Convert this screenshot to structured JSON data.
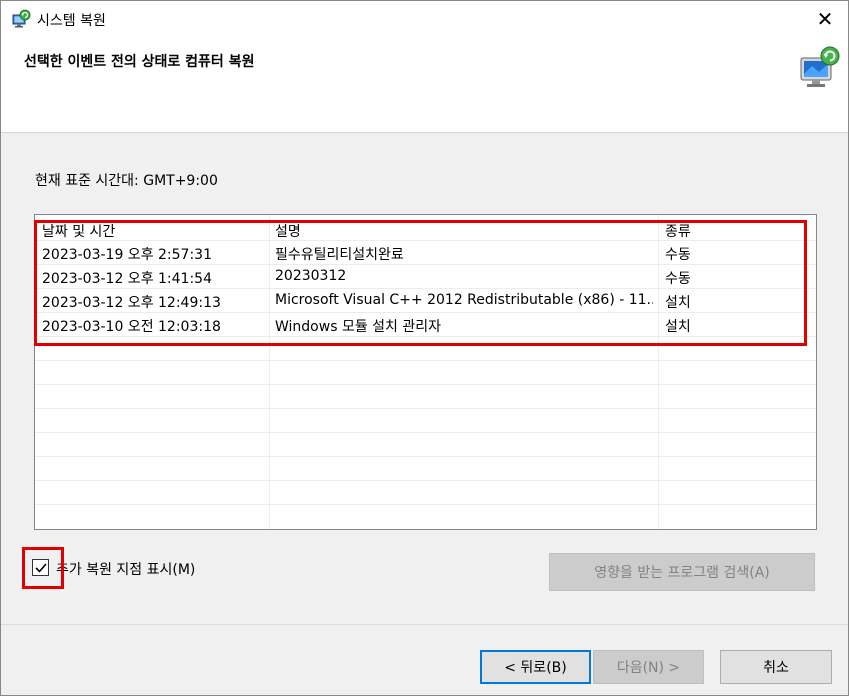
{
  "window": {
    "title": "시스템 복원",
    "close_glyph": "✕"
  },
  "header": {
    "heading": "선택한 이벤트 전의 상태로 컴퓨터 복원"
  },
  "timezone_label": "현재 표준 시간대: GMT+9:00",
  "table": {
    "columns": [
      "날짜 및 시간",
      "설명",
      "종류"
    ],
    "rows": [
      {
        "date": "2023-03-19 오후 2:57:31",
        "description": "필수유틸리티설치완료",
        "type": "수동"
      },
      {
        "date": "2023-03-12 오후 1:41:54",
        "description": "20230312",
        "type": "수동"
      },
      {
        "date": "2023-03-12 오후 12:49:13",
        "description": "Microsoft Visual C++ 2012 Redistributable (x86) - 11....",
        "type": "설치"
      },
      {
        "date": "2023-03-10 오전 12:03:18",
        "description": "Windows 모듈 설치 관리자",
        "type": "설치"
      }
    ]
  },
  "show_more": {
    "label": "추가 복원 지점 표시(M)",
    "checked": true
  },
  "buttons": {
    "scan": "영향을 받는 프로그램 검색(A)",
    "back": "< 뒤로(B)",
    "next": "다음(N) >",
    "cancel": "취소"
  },
  "icons": {
    "app": "system-restore-icon",
    "header": "system-restore-computer-icon"
  },
  "colors": {
    "highlight": "#e00000",
    "accent": "#0078d7",
    "dialog_bg": "#f0f0f0"
  }
}
